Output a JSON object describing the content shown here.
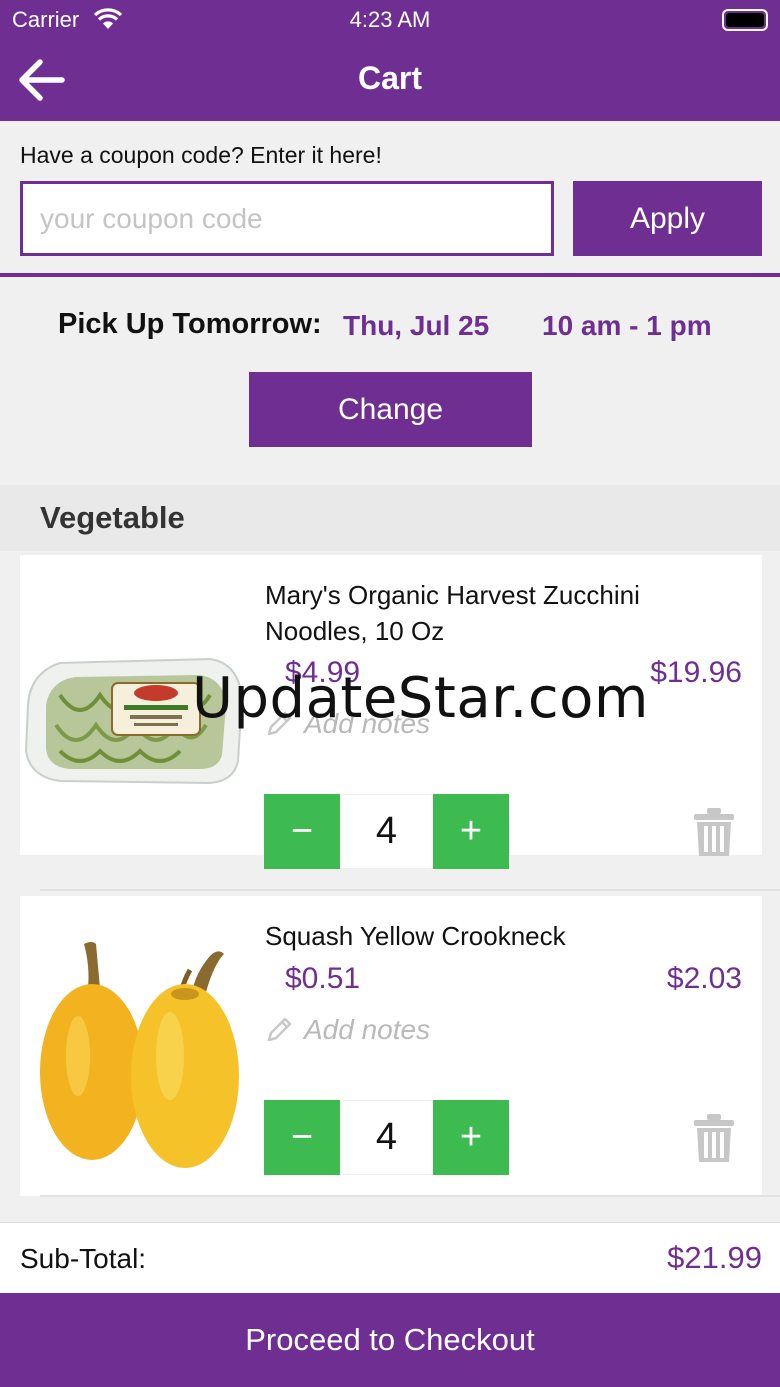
{
  "status_bar": {
    "carrier": "Carrier",
    "time": "4:23 AM"
  },
  "nav": {
    "title": "Cart"
  },
  "coupon": {
    "label": "Have a coupon code? Enter it here!",
    "placeholder": "your coupon code",
    "apply_label": "Apply"
  },
  "pickup": {
    "label": "Pick Up Tomorrow:",
    "date": "Thu, Jul 25",
    "time": "10 am - 1 pm",
    "change_label": "Change"
  },
  "section": {
    "title": "Vegetable"
  },
  "items": [
    {
      "name": "Mary's Organic Harvest Zucchini Noodles, 10 Oz",
      "unit_price": "$4.99",
      "total_price": "$19.96",
      "notes_placeholder": "Add notes",
      "quantity": "4",
      "minus": "−",
      "plus": "+"
    },
    {
      "name": "Squash Yellow Crookneck",
      "unit_price": "$0.51",
      "total_price": "$2.03",
      "notes_placeholder": "Add notes",
      "quantity": "4",
      "minus": "−",
      "plus": "+"
    }
  ],
  "summary": {
    "subtotal_label": "Sub-Total:",
    "subtotal_value": "$21.99"
  },
  "checkout": {
    "label": "Proceed to Checkout"
  },
  "watermark": "UpdateStar.com",
  "colors": {
    "brand": "#6f2e92",
    "stepper": "#3dbb50"
  }
}
